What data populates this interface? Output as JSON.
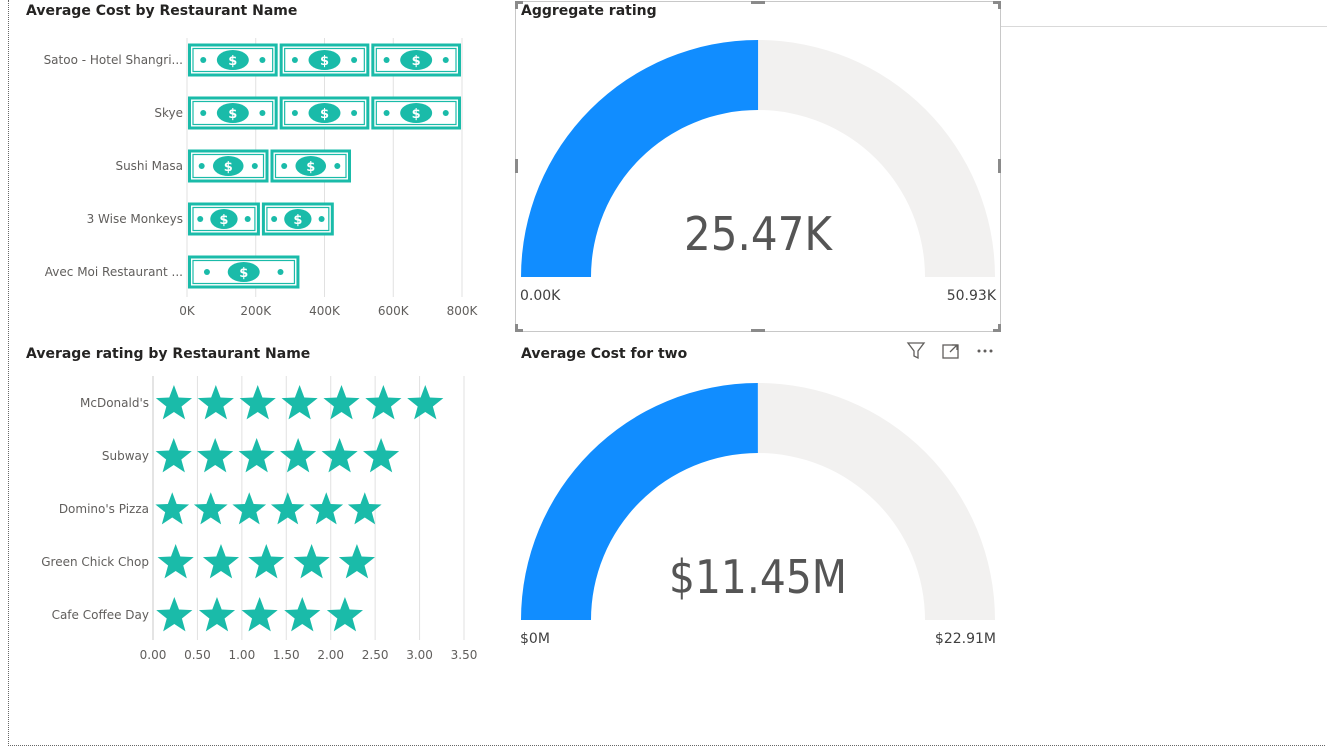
{
  "colors": {
    "teal": "#1ABBA9",
    "gauge_fill": "#118DFF",
    "gauge_track": "#F2F1F0",
    "grid": "#E1E1E1",
    "label": "#605E5C",
    "value": "#555555"
  },
  "icons": {
    "bar_mark": "dollar-bill-icon",
    "row_mark": "star-icon",
    "header": [
      "filter-icon",
      "focus-mode-icon",
      "more-options-icon"
    ]
  },
  "chart_data": [
    {
      "type": "bar",
      "title": "Average Cost by Restaurant Name",
      "mark": "dollar-bill-icon",
      "categories": [
        "Satoo - Hotel Shangri...",
        "Skye",
        "Sushi Masa",
        "3 Wise Monkeys",
        "Avec Moi Restaurant ..."
      ],
      "values": [
        800000,
        800000,
        480000,
        430000,
        330000
      ],
      "xlim": [
        0,
        800000
      ],
      "xticks": [
        "0K",
        "200K",
        "400K",
        "600K",
        "800K"
      ],
      "grid": true
    },
    {
      "type": "bar",
      "title": "Average rating by Restaurant Name",
      "mark": "star-icon",
      "categories": [
        "McDonald's",
        "Subway",
        "Domino's Pizza",
        "Green Chick Chop",
        "Cafe Coffee Day"
      ],
      "values": [
        3.3,
        2.8,
        2.6,
        2.55,
        2.4
      ],
      "xlim": [
        0,
        3.5
      ],
      "xticks": [
        "0.00",
        "0.50",
        "1.00",
        "1.50",
        "2.00",
        "2.50",
        "3.00",
        "3.50"
      ],
      "grid": true
    },
    {
      "type": "gauge",
      "title": "Aggregate rating",
      "value": 25470,
      "value_label": "25.47K",
      "min": 0,
      "max": 50930,
      "min_label": "0.00K",
      "max_label": "50.93K"
    },
    {
      "type": "gauge",
      "title": "Average Cost for two",
      "value": 11450000,
      "value_label": "$11.45M",
      "min": 0,
      "max": 22910000,
      "min_label": "$0M",
      "max_label": "$22.91M"
    }
  ]
}
